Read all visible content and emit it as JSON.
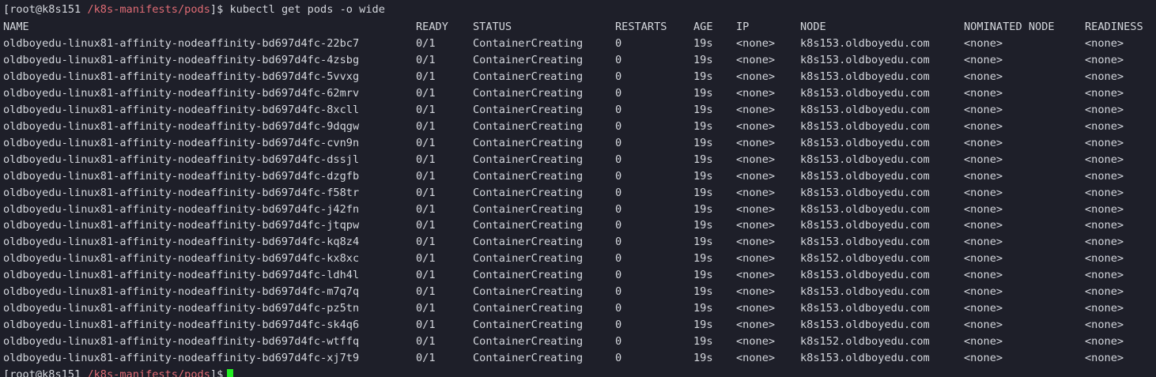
{
  "terminal": {
    "prompt1": {
      "open": "[",
      "user_host": "root@k8s151",
      "path": "/k8s-manifests/pods",
      "close": "]$",
      "command": "kubectl get pods -o wide"
    },
    "headers": {
      "name": "NAME",
      "ready": "READY",
      "status": "STATUS",
      "restarts": "RESTARTS",
      "age": "AGE",
      "ip": "IP",
      "node": "NODE",
      "nominated": "NOMINATED NODE",
      "readiness": "READINESS"
    },
    "rows": [
      {
        "name": "oldboyedu-linux81-affinity-nodeaffinity-bd697d4fc-22bc7",
        "ready": "0/1",
        "status": "ContainerCreating",
        "restarts": "0",
        "age": "19s",
        "ip": "<none>",
        "node": "k8s153.oldboyedu.com",
        "nominated": "<none>",
        "readiness": "<none>"
      },
      {
        "name": "oldboyedu-linux81-affinity-nodeaffinity-bd697d4fc-4zsbg",
        "ready": "0/1",
        "status": "ContainerCreating",
        "restarts": "0",
        "age": "19s",
        "ip": "<none>",
        "node": "k8s153.oldboyedu.com",
        "nominated": "<none>",
        "readiness": "<none>"
      },
      {
        "name": "oldboyedu-linux81-affinity-nodeaffinity-bd697d4fc-5vvxg",
        "ready": "0/1",
        "status": "ContainerCreating",
        "restarts": "0",
        "age": "19s",
        "ip": "<none>",
        "node": "k8s153.oldboyedu.com",
        "nominated": "<none>",
        "readiness": "<none>"
      },
      {
        "name": "oldboyedu-linux81-affinity-nodeaffinity-bd697d4fc-62mrv",
        "ready": "0/1",
        "status": "ContainerCreating",
        "restarts": "0",
        "age": "19s",
        "ip": "<none>",
        "node": "k8s153.oldboyedu.com",
        "nominated": "<none>",
        "readiness": "<none>"
      },
      {
        "name": "oldboyedu-linux81-affinity-nodeaffinity-bd697d4fc-8xcll",
        "ready": "0/1",
        "status": "ContainerCreating",
        "restarts": "0",
        "age": "19s",
        "ip": "<none>",
        "node": "k8s153.oldboyedu.com",
        "nominated": "<none>",
        "readiness": "<none>"
      },
      {
        "name": "oldboyedu-linux81-affinity-nodeaffinity-bd697d4fc-9dqgw",
        "ready": "0/1",
        "status": "ContainerCreating",
        "restarts": "0",
        "age": "19s",
        "ip": "<none>",
        "node": "k8s153.oldboyedu.com",
        "nominated": "<none>",
        "readiness": "<none>"
      },
      {
        "name": "oldboyedu-linux81-affinity-nodeaffinity-bd697d4fc-cvn9n",
        "ready": "0/1",
        "status": "ContainerCreating",
        "restarts": "0",
        "age": "19s",
        "ip": "<none>",
        "node": "k8s153.oldboyedu.com",
        "nominated": "<none>",
        "readiness": "<none>"
      },
      {
        "name": "oldboyedu-linux81-affinity-nodeaffinity-bd697d4fc-dssjl",
        "ready": "0/1",
        "status": "ContainerCreating",
        "restarts": "0",
        "age": "19s",
        "ip": "<none>",
        "node": "k8s153.oldboyedu.com",
        "nominated": "<none>",
        "readiness": "<none>"
      },
      {
        "name": "oldboyedu-linux81-affinity-nodeaffinity-bd697d4fc-dzgfb",
        "ready": "0/1",
        "status": "ContainerCreating",
        "restarts": "0",
        "age": "19s",
        "ip": "<none>",
        "node": "k8s153.oldboyedu.com",
        "nominated": "<none>",
        "readiness": "<none>"
      },
      {
        "name": "oldboyedu-linux81-affinity-nodeaffinity-bd697d4fc-f58tr",
        "ready": "0/1",
        "status": "ContainerCreating",
        "restarts": "0",
        "age": "19s",
        "ip": "<none>",
        "node": "k8s153.oldboyedu.com",
        "nominated": "<none>",
        "readiness": "<none>"
      },
      {
        "name": "oldboyedu-linux81-affinity-nodeaffinity-bd697d4fc-j42fn",
        "ready": "0/1",
        "status": "ContainerCreating",
        "restarts": "0",
        "age": "19s",
        "ip": "<none>",
        "node": "k8s153.oldboyedu.com",
        "nominated": "<none>",
        "readiness": "<none>"
      },
      {
        "name": "oldboyedu-linux81-affinity-nodeaffinity-bd697d4fc-jtqpw",
        "ready": "0/1",
        "status": "ContainerCreating",
        "restarts": "0",
        "age": "19s",
        "ip": "<none>",
        "node": "k8s153.oldboyedu.com",
        "nominated": "<none>",
        "readiness": "<none>"
      },
      {
        "name": "oldboyedu-linux81-affinity-nodeaffinity-bd697d4fc-kq8z4",
        "ready": "0/1",
        "status": "ContainerCreating",
        "restarts": "0",
        "age": "19s",
        "ip": "<none>",
        "node": "k8s153.oldboyedu.com",
        "nominated": "<none>",
        "readiness": "<none>"
      },
      {
        "name": "oldboyedu-linux81-affinity-nodeaffinity-bd697d4fc-kx8xc",
        "ready": "0/1",
        "status": "ContainerCreating",
        "restarts": "0",
        "age": "19s",
        "ip": "<none>",
        "node": "k8s152.oldboyedu.com",
        "nominated": "<none>",
        "readiness": "<none>"
      },
      {
        "name": "oldboyedu-linux81-affinity-nodeaffinity-bd697d4fc-ldh4l",
        "ready": "0/1",
        "status": "ContainerCreating",
        "restarts": "0",
        "age": "19s",
        "ip": "<none>",
        "node": "k8s153.oldboyedu.com",
        "nominated": "<none>",
        "readiness": "<none>"
      },
      {
        "name": "oldboyedu-linux81-affinity-nodeaffinity-bd697d4fc-m7q7q",
        "ready": "0/1",
        "status": "ContainerCreating",
        "restarts": "0",
        "age": "19s",
        "ip": "<none>",
        "node": "k8s153.oldboyedu.com",
        "nominated": "<none>",
        "readiness": "<none>"
      },
      {
        "name": "oldboyedu-linux81-affinity-nodeaffinity-bd697d4fc-pz5tn",
        "ready": "0/1",
        "status": "ContainerCreating",
        "restarts": "0",
        "age": "19s",
        "ip": "<none>",
        "node": "k8s153.oldboyedu.com",
        "nominated": "<none>",
        "readiness": "<none>"
      },
      {
        "name": "oldboyedu-linux81-affinity-nodeaffinity-bd697d4fc-sk4q6",
        "ready": "0/1",
        "status": "ContainerCreating",
        "restarts": "0",
        "age": "19s",
        "ip": "<none>",
        "node": "k8s153.oldboyedu.com",
        "nominated": "<none>",
        "readiness": "<none>"
      },
      {
        "name": "oldboyedu-linux81-affinity-nodeaffinity-bd697d4fc-wtffq",
        "ready": "0/1",
        "status": "ContainerCreating",
        "restarts": "0",
        "age": "19s",
        "ip": "<none>",
        "node": "k8s152.oldboyedu.com",
        "nominated": "<none>",
        "readiness": "<none>"
      },
      {
        "name": "oldboyedu-linux81-affinity-nodeaffinity-bd697d4fc-xj7t9",
        "ready": "0/1",
        "status": "ContainerCreating",
        "restarts": "0",
        "age": "19s",
        "ip": "<none>",
        "node": "k8s153.oldboyedu.com",
        "nominated": "<none>",
        "readiness": "<none>"
      }
    ],
    "prompt2": {
      "open": "[",
      "user_host": "root@k8s151",
      "path": "/k8s-manifests/pods",
      "close": "]$"
    },
    "colors": {
      "background": "#1e1f29",
      "foreground": "#d4d7dd",
      "path": "#e06c75",
      "cursor": "#22ee22"
    }
  }
}
